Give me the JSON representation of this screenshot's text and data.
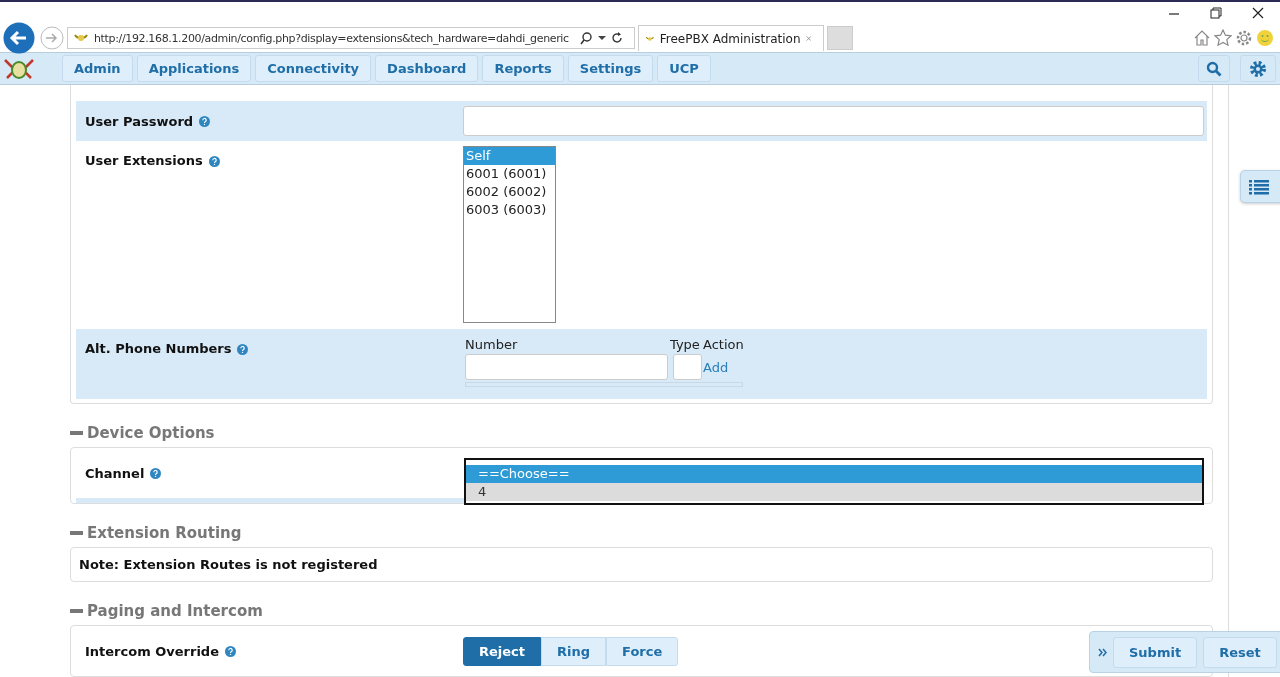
{
  "browser": {
    "url": "http://192.168.1.200/admin/config.php?display=extensions&tech_hardware=dahdi_generic",
    "tab_title": "FreePBX Administration"
  },
  "nav": {
    "items": [
      {
        "label": "Admin"
      },
      {
        "label": "Applications"
      },
      {
        "label": "Connectivity"
      },
      {
        "label": "Dashboard"
      },
      {
        "label": "Reports"
      },
      {
        "label": "Settings"
      },
      {
        "label": "UCP"
      }
    ]
  },
  "user_password": {
    "label": "User Password"
  },
  "user_extensions": {
    "label": "User Extensions",
    "options": [
      {
        "label": "Self",
        "selected": true
      },
      {
        "label": "6001 (6001)",
        "selected": false
      },
      {
        "label": "6002 (6002)",
        "selected": false
      },
      {
        "label": "6003 (6003)",
        "selected": false
      }
    ]
  },
  "alt_phone_numbers": {
    "label": "Alt. Phone Numbers",
    "columns": [
      "Number",
      "Type",
      "Action"
    ],
    "add_link": "Add"
  },
  "device_options": {
    "title": "Device Options",
    "channel": {
      "label": "Channel",
      "options": [
        {
          "label": "==Choose==",
          "selected": true,
          "hovered": false
        },
        {
          "label": "4",
          "selected": false,
          "hovered": true
        }
      ]
    }
  },
  "extension_routing": {
    "title": "Extension Routing",
    "note": "Note: Extension Routes is not registered"
  },
  "paging_intercom": {
    "title": "Paging and Intercom",
    "intercom_override": {
      "label": "Intercom Override",
      "options": [
        {
          "label": "Reject",
          "selected": true
        },
        {
          "label": "Ring",
          "selected": false
        },
        {
          "label": "Force",
          "selected": false
        }
      ]
    }
  },
  "actions": [
    "Submit",
    "Reset"
  ]
}
